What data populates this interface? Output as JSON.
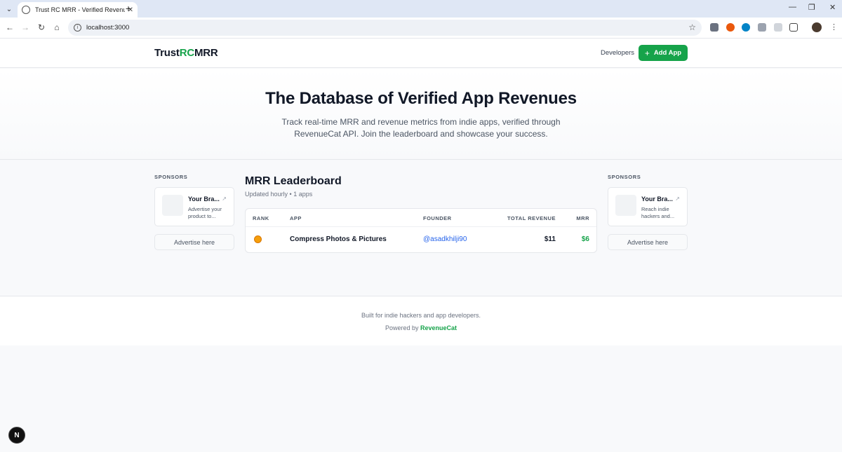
{
  "browser": {
    "tab_title": "Trust RC MRR - Verified Revenue",
    "url": "localhost:3000"
  },
  "header": {
    "logo_prefix": "Trust",
    "logo_highlight": "RC",
    "logo_suffix": "MRR",
    "developers_link": "Developers",
    "add_app_label": "Add App"
  },
  "hero": {
    "title": "The Database of Verified App Revenues",
    "subtitle": "Track real-time MRR and revenue metrics from indie apps, verified through RevenueCat API. Join the leaderboard and showcase your success."
  },
  "sponsors": {
    "left": {
      "label": "SPONSORS",
      "name": "Your Bra...",
      "description": "Advertise your product to...",
      "advertise_label": "Advertise here"
    },
    "right": {
      "label": "SPONSORS",
      "name": "Your Bra...",
      "description": "Reach indie hackers and...",
      "advertise_label": "Advertise here"
    }
  },
  "leaderboard": {
    "title": "MRR Leaderboard",
    "subtitle": "Updated hourly • 1 apps",
    "columns": {
      "rank": "RANK",
      "app": "APP",
      "founder": "FOUNDER",
      "total_revenue": "TOTAL REVENUE",
      "mrr": "MRR"
    },
    "rows": [
      {
        "rank_icon": "medal-icon",
        "app": "Compress Photos & Pictures",
        "founder": "@asadkhilji90",
        "total_revenue": "$11",
        "mrr": "$6"
      }
    ]
  },
  "footer": {
    "line1": "Built for indie hackers and app developers.",
    "powered_prefix": "Powered by",
    "powered_link": "RevenueCat"
  },
  "dev_badge": "N",
  "colors": {
    "brand_green": "#16a34a",
    "link_blue": "#2563eb"
  }
}
